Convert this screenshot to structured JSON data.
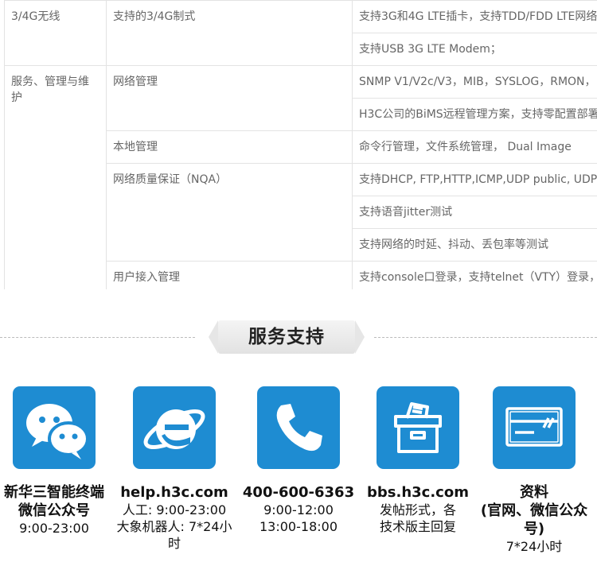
{
  "spec_table": {
    "row_4g": {
      "category": "3/4G无线",
      "feature": "支持的3/4G制式",
      "details": [
        "支持3G和4G LTE插卡，支持TDD/FDD LTE网络",
        "支持USB 3G LTE Modem；"
      ]
    },
    "row_mgmt": {
      "category": "服务、管理与维护",
      "network_mgmt": {
        "feature": "网络管理",
        "details": [
          "SNMP V1/V2c/V3，MIB，SYSLOG，RMON，",
          "H3C公司的BiMS远程管理方案，支持零配置部署"
        ]
      },
      "local_mgmt": {
        "feature": "本地管理",
        "details": [
          "命令行管理，文件系统管理， Dual Image"
        ]
      },
      "nqa": {
        "feature": "网络质量保证（NQA）",
        "details": [
          "支持DHCP, FTP,HTTP,ICMP,UDP public, UDP p",
          "支持语音jitter测试",
          "支持网络的时延、抖动、丢包率等测试"
        ]
      },
      "access_mgmt": {
        "feature": "用户接入管理",
        "details": [
          "支持console口登录，支持telnet（VTY）登录，支"
        ]
      }
    }
  },
  "service_section": {
    "title": "服务支持"
  },
  "services": [
    {
      "icon": "wechat-icon",
      "title": "新华三智能终端",
      "lines": [
        "微信公众号",
        "9:00-23:00"
      ]
    },
    {
      "icon": "ie-browser-icon",
      "title": "help.h3c.com",
      "lines": [
        "人工: 9:00-23:00",
        "大象机器人: 7*24小时"
      ]
    },
    {
      "icon": "phone-icon",
      "title": "400-600-6363",
      "lines": [
        "9:00-12:00",
        "13:00-18:00"
      ]
    },
    {
      "icon": "archive-box-icon",
      "title": "bbs.h3c.com",
      "lines": [
        "发帖形式，各",
        "技术版主回复"
      ]
    },
    {
      "icon": "card-icon",
      "title": "资料",
      "lines": [
        "(官网、微信公众号)",
        "7*24小时"
      ]
    }
  ],
  "colors": {
    "icon_bg": "#1e8cd2",
    "border": "#e3e3e3",
    "text": "#666666"
  }
}
